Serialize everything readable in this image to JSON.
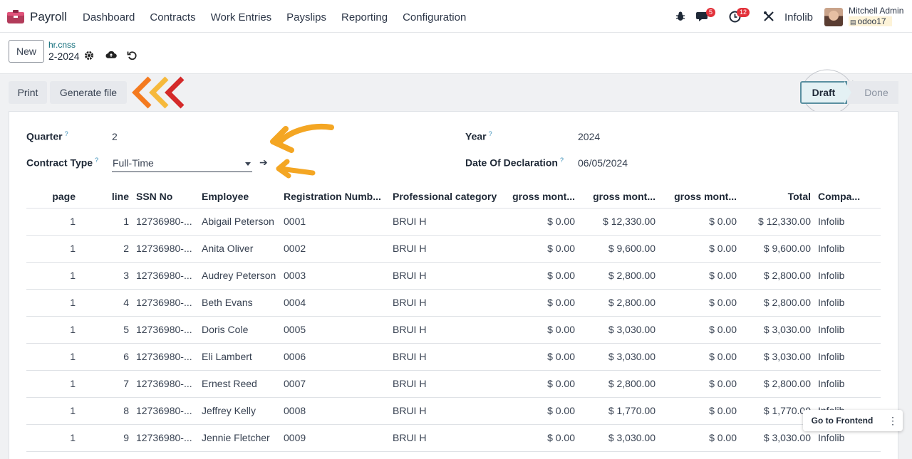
{
  "navbar": {
    "brand": "Payroll",
    "menu": [
      "Dashboard",
      "Contracts",
      "Work Entries",
      "Payslips",
      "Reporting",
      "Configuration"
    ],
    "messages_badge": "5",
    "activities_badge": "12",
    "company": "Infolib",
    "user_name": "Mitchell Admin",
    "db_name": "odoo17",
    "icons": [
      "bug-icon",
      "chat-icon",
      "clock-icon",
      "tools-icon"
    ]
  },
  "control": {
    "new_label": "New",
    "breadcrumb_model": "hr.cnss",
    "breadcrumb_record": "2-2024"
  },
  "statusbar": {
    "print_label": "Print",
    "generate_label": "Generate file",
    "states": [
      "Draft",
      "Done"
    ],
    "active_state": "Draft"
  },
  "form": {
    "quarter_label": "Quarter",
    "quarter_value": "2",
    "contract_type_label": "Contract Type",
    "contract_type_value": "Full-Time",
    "year_label": "Year",
    "year_value": "2024",
    "declaration_label": "Date Of Declaration",
    "declaration_value": "06/05/2024",
    "help_mark": "?"
  },
  "table": {
    "headers": [
      "page",
      "line",
      "SSN No",
      "Employee",
      "Registration Numb...",
      "Professional category",
      "gross mont...",
      "gross mont...",
      "gross mont...",
      "Total",
      "Compa..."
    ],
    "rows": [
      [
        "1",
        "1",
        "12736980-...",
        "Abigail Peterson",
        "0001",
        "BRUI H",
        "$ 0.00",
        "$ 12,330.00",
        "$ 0.00",
        "$ 12,330.00",
        "Infolib"
      ],
      [
        "1",
        "2",
        "12736980-...",
        "Anita Oliver",
        "0002",
        "BRUI H",
        "$ 0.00",
        "$ 9,600.00",
        "$ 0.00",
        "$ 9,600.00",
        "Infolib"
      ],
      [
        "1",
        "3",
        "12736980-...",
        "Audrey Peterson",
        "0003",
        "BRUI H",
        "$ 0.00",
        "$ 2,800.00",
        "$ 0.00",
        "$ 2,800.00",
        "Infolib"
      ],
      [
        "1",
        "4",
        "12736980-...",
        "Beth Evans",
        "0004",
        "BRUI H",
        "$ 0.00",
        "$ 2,800.00",
        "$ 0.00",
        "$ 2,800.00",
        "Infolib"
      ],
      [
        "1",
        "5",
        "12736980-...",
        "Doris Cole",
        "0005",
        "BRUI H",
        "$ 0.00",
        "$ 3,030.00",
        "$ 0.00",
        "$ 3,030.00",
        "Infolib"
      ],
      [
        "1",
        "6",
        "12736980-...",
        "Eli Lambert",
        "0006",
        "BRUI H",
        "$ 0.00",
        "$ 3,030.00",
        "$ 0.00",
        "$ 3,030.00",
        "Infolib"
      ],
      [
        "1",
        "7",
        "12736980-...",
        "Ernest Reed",
        "0007",
        "BRUI H",
        "$ 0.00",
        "$ 2,800.00",
        "$ 0.00",
        "$ 2,800.00",
        "Infolib"
      ],
      [
        "1",
        "8",
        "12736980-...",
        "Jeffrey Kelly",
        "0008",
        "BRUI H",
        "$ 0.00",
        "$ 1,770.00",
        "$ 0.00",
        "$ 1,770.00",
        "Infolib"
      ],
      [
        "1",
        "9",
        "12736980-...",
        "Jennie Fletcher",
        "0009",
        "BRUI H",
        "$ 0.00",
        "$ 3,030.00",
        "$ 0.00",
        "$ 3,030.00",
        "Infolib"
      ]
    ]
  },
  "floating": {
    "frontend_label": "Go to Frontend",
    "kebab": "⋮"
  },
  "colors": {
    "accent_teal": "#0c6a78",
    "badge_red": "#e2313a",
    "arrow_orange": "#f4a623",
    "chevron_red": "#d42a2a"
  }
}
